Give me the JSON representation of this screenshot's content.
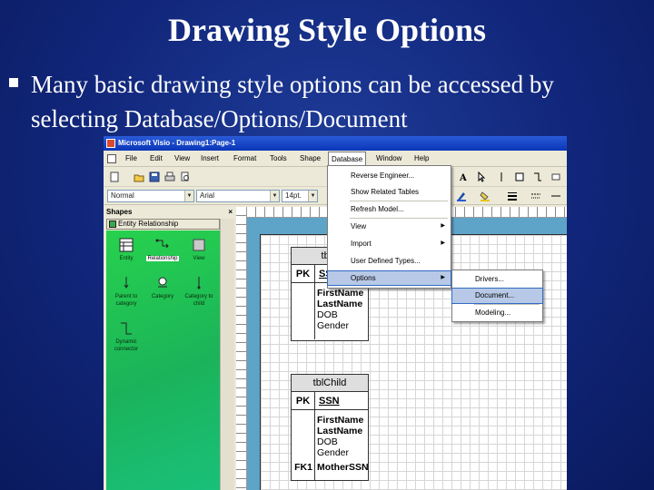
{
  "slide": {
    "title": "Drawing Style Options",
    "bullet_text": "Many basic drawing style options can be accessed by selecting Database/Options/Document"
  },
  "visio": {
    "window_title": "Microsoft Visio - Drawing1:Page-1",
    "menus": [
      "File",
      "Edit",
      "View",
      "Insert",
      "Format",
      "Tools",
      "Shape",
      "Database",
      "Window",
      "Help"
    ],
    "active_menu": "Database",
    "font_style_combo": "Normal",
    "font_combo": "Arial",
    "size_combo": "14pt.",
    "shapes_pane": {
      "title": "Shapes",
      "stencil": "Entity Relationship",
      "items": [
        "Entity",
        "Relationship",
        "View",
        "Parent to category",
        "Category",
        "Category to child",
        "Dynamic connector"
      ],
      "selected": "Relationship"
    },
    "database_menu": {
      "items": [
        {
          "label": "Reverse Engineer...",
          "submenu": false
        },
        {
          "label": "Show Related Tables",
          "submenu": false
        },
        {
          "label": "Refresh Model...",
          "submenu": false
        },
        {
          "label": "View",
          "submenu": true
        },
        {
          "label": "Import",
          "submenu": true
        },
        {
          "label": "User Defined Types...",
          "submenu": false
        },
        {
          "label": "Options",
          "submenu": true
        }
      ],
      "highlighted": "Options"
    },
    "options_submenu": {
      "items": [
        "Drivers...",
        "Document...",
        "Modeling..."
      ],
      "highlighted": "Document..."
    },
    "tables": [
      {
        "name": "tblP",
        "pk_label": "PK",
        "pk_field": "SSN",
        "fields_bold": [
          "FirstName",
          "LastName"
        ],
        "fields": [
          "DOB",
          "Gender"
        ]
      },
      {
        "name": "tblChild",
        "pk_label": "PK",
        "pk_field": "SSN",
        "fields_bold": [
          "FirstName",
          "LastName"
        ],
        "fields": [
          "DOB",
          "Gender"
        ],
        "fk_label": "FK1",
        "fk_field": "MotherSSN"
      }
    ],
    "colors": {
      "shapes_pane": "#22c85a",
      "drawing_background": "#5ea4c9",
      "menu_highlight": "#b7c9e6",
      "title_bar": "#0a36b8"
    }
  }
}
